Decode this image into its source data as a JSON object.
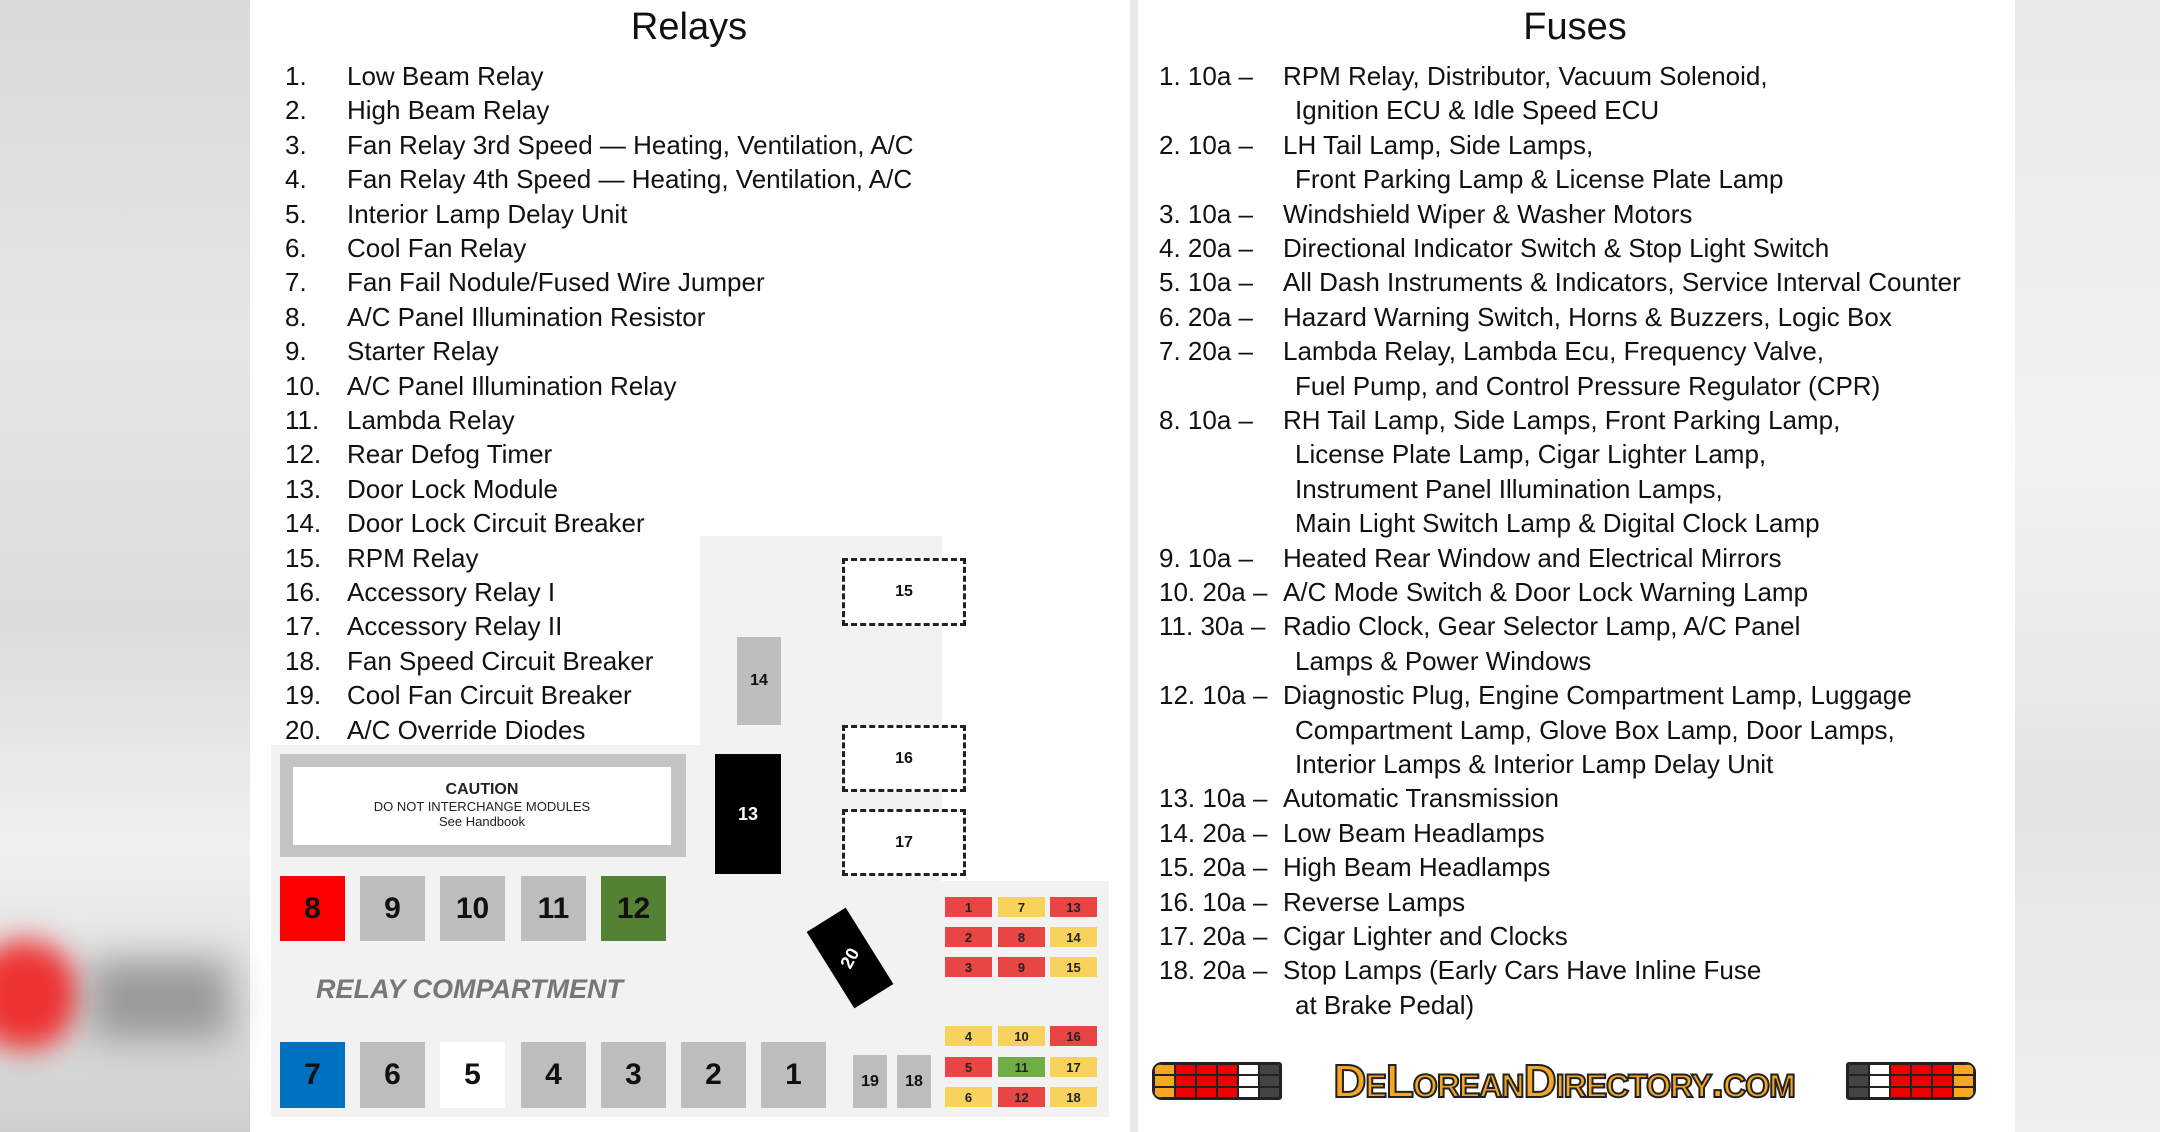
{
  "relays": {
    "title": "Relays",
    "items": [
      {
        "num": "1.",
        "label": "Low Beam Relay"
      },
      {
        "num": "2.",
        "label": "High Beam Relay"
      },
      {
        "num": "3.",
        "label": "Fan Relay 3rd Speed — Heating, Ventilation, A/C"
      },
      {
        "num": "4.",
        "label": "Fan Relay 4th Speed — Heating, Ventilation, A/C"
      },
      {
        "num": "5.",
        "label": "Interior Lamp Delay Unit"
      },
      {
        "num": "6.",
        "label": "Cool Fan Relay"
      },
      {
        "num": "7.",
        "label": "Fan Fail Nodule/Fused Wire Jumper"
      },
      {
        "num": "8.",
        "label": "A/C Panel Illumination Resistor"
      },
      {
        "num": "9.",
        "label": "Starter Relay"
      },
      {
        "num": "10.",
        "label": "A/C Panel Illumination Relay"
      },
      {
        "num": "11.",
        "label": "Lambda Relay"
      },
      {
        "num": "12.",
        "label": "Rear Defog Timer"
      },
      {
        "num": "13.",
        "label": "Door Lock Module"
      },
      {
        "num": "14.",
        "label": "Door Lock Circuit Breaker"
      },
      {
        "num": "15.",
        "label": "RPM Relay"
      },
      {
        "num": "16.",
        "label": "Accessory Relay I"
      },
      {
        "num": "17.",
        "label": "Accessory Relay II"
      },
      {
        "num": "18.",
        "label": "Fan Speed Circuit Breaker"
      },
      {
        "num": "19.",
        "label": "Cool Fan Circuit Breaker"
      },
      {
        "num": "20.",
        "label": "A/C Override Diodes"
      }
    ]
  },
  "fuses": {
    "title": "Fuses",
    "items": [
      {
        "label": "1. 10a –",
        "lines": [
          "RPM Relay, Distributor, Vacuum Solenoid,",
          "Ignition ECU & Idle Speed ECU"
        ]
      },
      {
        "label": "2. 10a –",
        "lines": [
          "LH Tail Lamp, Side Lamps,",
          "Front Parking Lamp & License Plate Lamp"
        ]
      },
      {
        "label": "3. 10a –",
        "lines": [
          "Windshield Wiper & Washer Motors"
        ]
      },
      {
        "label": "4. 20a –",
        "lines": [
          "Directional Indicator Switch & Stop Light Switch"
        ]
      },
      {
        "label": "5. 10a –",
        "lines": [
          "All Dash Instruments & Indicators, Service Interval Counter"
        ]
      },
      {
        "label": "6. 20a –",
        "lines": [
          "Hazard Warning Switch, Horns & Buzzers, Logic Box"
        ]
      },
      {
        "label": "7. 20a –",
        "lines": [
          "Lambda Relay, Lambda Ecu, Frequency Valve,",
          "Fuel Pump, and Control Pressure Regulator (CPR)"
        ]
      },
      {
        "label": "8. 10a –",
        "lines": [
          "RH Tail Lamp, Side Lamps, Front Parking Lamp,",
          "License Plate Lamp, Cigar Lighter Lamp,",
          "Instrument Panel Illumination Lamps,",
          "Main Light Switch Lamp & Digital Clock Lamp"
        ]
      },
      {
        "label": "9. 10a –",
        "lines": [
          "Heated Rear Window and Electrical Mirrors"
        ]
      },
      {
        "label": "10. 20a –",
        "lines": [
          "A/C Mode Switch & Door Lock Warning Lamp"
        ]
      },
      {
        "label": "11. 30a –",
        "lines": [
          "Radio Clock, Gear Selector Lamp, A/C Panel",
          "Lamps & Power Windows"
        ]
      },
      {
        "label": "12. 10a –",
        "lines": [
          "Diagnostic Plug, Engine Compartment Lamp, Luggage",
          "Compartment Lamp, Glove Box Lamp, Door Lamps,",
          "Interior Lamps & Interior Lamp Delay Unit"
        ]
      },
      {
        "label": "13. 10a –",
        "lines": [
          "Automatic Transmission"
        ]
      },
      {
        "label": "14. 20a –",
        "lines": [
          "Low Beam Headlamps"
        ]
      },
      {
        "label": "15. 20a –",
        "lines": [
          "High Beam Headlamps"
        ]
      },
      {
        "label": "16. 10a –",
        "lines": [
          "Reverse Lamps"
        ]
      },
      {
        "label": "17. 20a –",
        "lines": [
          "Cigar Lighter and Clocks"
        ]
      },
      {
        "label": "18. 20a –",
        "lines": [
          "Stop Lamps (Early Cars Have Inline Fuse",
          "at Brake Pedal)"
        ]
      }
    ]
  },
  "diagram": {
    "caution_title": "CAUTION",
    "caution_line1": "DO NOT INTERCHANGE MODULES",
    "caution_line2": "See Handbook",
    "compartment_label": "RELAY COMPARTMENT",
    "colors": {
      "red": "#ff0000",
      "gray": "#bdbdbd",
      "green": "#548235",
      "blue": "#0070c0",
      "white": "#ffffff",
      "black": "#000000",
      "fuse_red": "#e84545",
      "fuse_yellow": "#f7d25c",
      "fuse_green": "#70ad47"
    },
    "upper_row": [
      {
        "n": "8",
        "color": "red"
      },
      {
        "n": "9",
        "color": "gray"
      },
      {
        "n": "10",
        "color": "gray"
      },
      {
        "n": "11",
        "color": "gray"
      },
      {
        "n": "12",
        "color": "green"
      }
    ],
    "lower_row": [
      {
        "n": "7",
        "color": "blue"
      },
      {
        "n": "6",
        "color": "gray"
      },
      {
        "n": "5",
        "color": "white"
      },
      {
        "n": "4",
        "color": "gray"
      },
      {
        "n": "3",
        "color": "gray"
      },
      {
        "n": "2",
        "color": "gray"
      },
      {
        "n": "1",
        "color": "gray"
      }
    ],
    "relay13": "13",
    "relay14": "14",
    "relay15": "15",
    "relay16": "16",
    "relay17": "17",
    "relay18": "18",
    "relay19": "19",
    "relay20": "20",
    "fuse_block_upper": [
      [
        {
          "n": "1",
          "c": "fuse_red"
        },
        {
          "n": "7",
          "c": "fuse_yellow"
        },
        {
          "n": "13",
          "c": "fuse_red"
        }
      ],
      [
        {
          "n": "2",
          "c": "fuse_red"
        },
        {
          "n": "8",
          "c": "fuse_red"
        },
        {
          "n": "14",
          "c": "fuse_yellow"
        }
      ],
      [
        {
          "n": "3",
          "c": "fuse_red"
        },
        {
          "n": "9",
          "c": "fuse_red"
        },
        {
          "n": "15",
          "c": "fuse_yellow"
        }
      ]
    ],
    "fuse_block_lower": [
      [
        {
          "n": "4",
          "c": "fuse_yellow"
        },
        {
          "n": "10",
          "c": "fuse_yellow"
        },
        {
          "n": "16",
          "c": "fuse_red"
        }
      ],
      [
        {
          "n": "5",
          "c": "fuse_red"
        },
        {
          "n": "11",
          "c": "fuse_green"
        },
        {
          "n": "17",
          "c": "fuse_yellow"
        }
      ],
      [
        {
          "n": "6",
          "c": "fuse_yellow"
        },
        {
          "n": "12",
          "c": "fuse_red"
        },
        {
          "n": "18",
          "c": "fuse_yellow"
        }
      ]
    ]
  },
  "logo": {
    "text": "DeLoreanDirectory.com"
  }
}
